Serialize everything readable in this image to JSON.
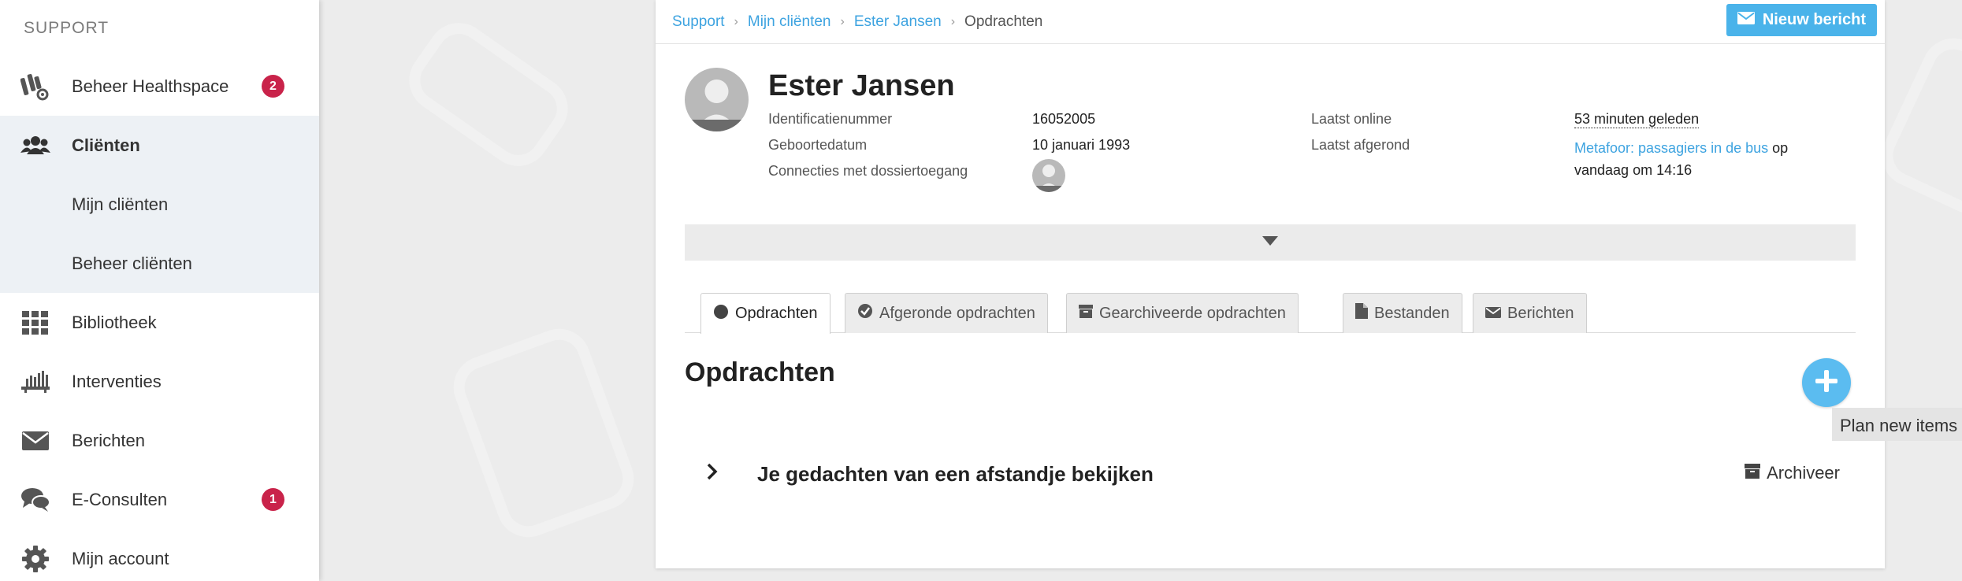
{
  "sidebar": {
    "header": "SUPPORT",
    "items": [
      {
        "label": "Beheer Healthspace",
        "icon": "healthspace-settings-icon",
        "badge": "2"
      },
      {
        "label": "Cliënten",
        "icon": "users-icon"
      },
      {
        "label": "Mijn cliënten"
      },
      {
        "label": "Beheer cliënten"
      },
      {
        "label": "Bibliotheek",
        "icon": "grid-icon"
      },
      {
        "label": "Interventies",
        "icon": "interventions-icon"
      },
      {
        "label": "Berichten",
        "icon": "envelope-icon"
      },
      {
        "label": "E-Consulten",
        "icon": "chat-bubbles-icon",
        "badge": "1"
      },
      {
        "label": "Mijn account",
        "icon": "gear-icon"
      }
    ]
  },
  "breadcrumb": {
    "items": [
      "Support",
      "Mijn cliënten",
      "Ester Jansen"
    ],
    "current": "Opdrachten"
  },
  "toolbar": {
    "new_message_label": "Nieuw bericht"
  },
  "profile": {
    "name": "Ester Jansen",
    "id_label": "Identificatienummer",
    "id_value": "16052005",
    "dob_label": "Geboortedatum",
    "dob_value": "10 januari 1993",
    "connections_label": "Connecties met dossiertoegang",
    "last_online_label": "Laatst online",
    "last_online_value": "53 minuten geleden",
    "last_completed_label": "Laatst afgerond",
    "last_completed_link": "Metafoor: passagiers in de bus",
    "last_completed_suffix": " op",
    "last_completed_time": "vandaag om 14:16"
  },
  "tabs": [
    {
      "label": "Opdrachten",
      "icon": "circle-icon",
      "active": true
    },
    {
      "label": "Afgeronde opdrachten",
      "icon": "check-circle-icon"
    },
    {
      "label": "Gearchiveerde opdrachten",
      "icon": "archive-icon"
    },
    {
      "label": "Bestanden",
      "icon": "file-icon"
    },
    {
      "label": "Berichten",
      "icon": "envelope-icon"
    }
  ],
  "main": {
    "section_title": "Opdrachten",
    "add_tooltip": "Plan new items",
    "tasks": [
      {
        "title": "Je gedachten van een afstandje bekijken",
        "action": "Archiveer"
      }
    ]
  },
  "colors": {
    "accent": "#3da3e0",
    "button": "#4ab3ea",
    "badge": "#c9234a",
    "active_nav_bg": "#edf1f5"
  }
}
